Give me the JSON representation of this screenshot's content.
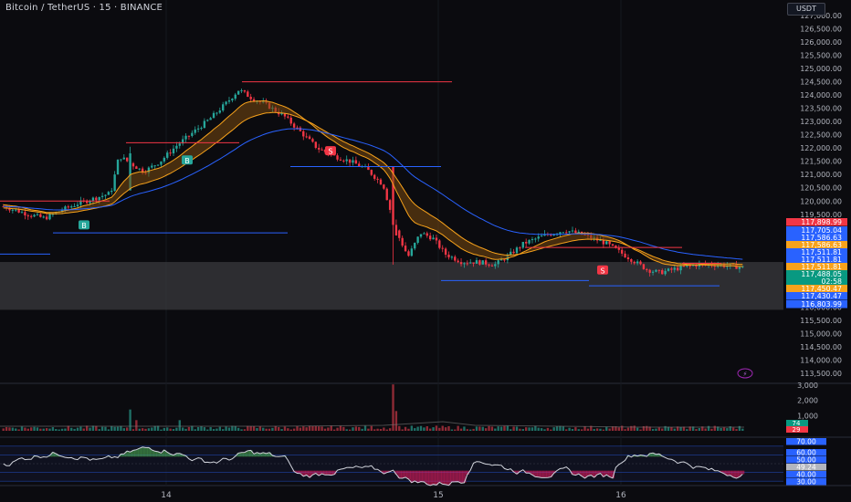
{
  "header": {
    "symbol_title": "Bitcoin / TetherUS · 15 · BINANCE",
    "currency": "USDT"
  },
  "price_axis": {
    "ticks": [
      "127,000.00",
      "126,500.00",
      "126,000.00",
      "125,500.00",
      "125,000.00",
      "124,500.00",
      "124,000.00",
      "123,500.00",
      "123,000.00",
      "122,500.00",
      "122,000.00",
      "121,500.00",
      "121,000.00",
      "120,500.00",
      "120,000.00",
      "119,500.00",
      "116,000.00",
      "115,500.00",
      "115,000.00",
      "114,500.00",
      "114,000.00",
      "113,500.00"
    ]
  },
  "price_labels": [
    {
      "text": "117,898.99",
      "color": "#f23645"
    },
    {
      "text": "117,705.04",
      "color": "#2962ff"
    },
    {
      "text": "117,586.63",
      "color": "#2962ff"
    },
    {
      "text": "117,586.63",
      "color": "#f7a21b"
    },
    {
      "text": "117,511.81",
      "color": "#2962ff"
    },
    {
      "text": "117,511.81",
      "color": "#2962ff"
    },
    {
      "text": "117,511.81",
      "color": "#f7a21b"
    },
    {
      "text": "117,488.05",
      "color": "#089981"
    },
    {
      "text": "02:58",
      "color": "#089981"
    },
    {
      "text": "117,450.47",
      "color": "#f7a21b"
    },
    {
      "text": "117,430.47",
      "color": "#2962ff"
    },
    {
      "text": "116,803.99",
      "color": "#2962ff"
    }
  ],
  "volume_axis": {
    "ticks": [
      "3,000",
      "2,000",
      "1,000"
    ],
    "labels": [
      {
        "text": "74",
        "color": "#089981"
      },
      {
        "text": "29",
        "color": "#f23645"
      }
    ]
  },
  "rsi_axis": {
    "ticks": [
      "70.00",
      "60.00",
      "50.00",
      "40.00",
      "30.00"
    ],
    "labels": [
      {
        "text": "70.00",
        "color": "#2962ff"
      },
      {
        "text": "60.00",
        "color": "#2962ff"
      },
      {
        "text": "50.00",
        "color": "#2962ff"
      },
      {
        "text": "49.24",
        "color": "#b2b5be"
      },
      {
        "text": "40.00",
        "color": "#2962ff"
      },
      {
        "text": "30.00",
        "color": "#2962ff"
      }
    ]
  },
  "time_axis": {
    "labels": [
      "14",
      "15",
      "16"
    ]
  },
  "markers": [
    {
      "type": "B",
      "color": "#26a69a"
    },
    {
      "type": "B",
      "color": "#26a69a"
    },
    {
      "type": "S",
      "color": "#f23645"
    },
    {
      "type": "S",
      "color": "#f23645"
    }
  ],
  "lightning_icon": "lightning-icon",
  "colors": {
    "up": "#26a69a",
    "down": "#f23645",
    "ema": "#2962ff",
    "ribbon": "#f7a21b"
  }
}
